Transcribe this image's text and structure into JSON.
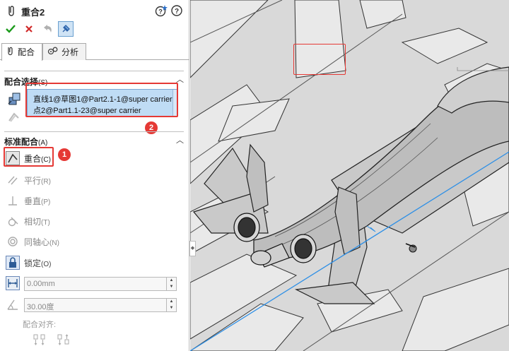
{
  "header": {
    "title": "重合2",
    "icon": "paperclip-icon",
    "help_icons": [
      "help-star-icon",
      "help-icon"
    ]
  },
  "actions": {
    "ok_icon": "checkmark-icon",
    "cancel_icon": "x-icon",
    "undo_icon": "undo-icon",
    "pin_icon": "pushpin-icon"
  },
  "tabs": [
    {
      "label": "配合",
      "icon": "paperclip-icon",
      "active": true
    },
    {
      "label": "分析",
      "icon": "gears-icon",
      "active": false
    }
  ],
  "mate_selection": {
    "title": "配合选择",
    "hotkey": "(S)",
    "items": [
      "直线1@草图1@Part2.1-1@super carrier",
      "点2@Part1.1-23@super carrier"
    ],
    "badge": "2"
  },
  "standard_mates": {
    "title": "标准配合",
    "hotkey": "(A)",
    "badge": "1",
    "items": [
      {
        "label": "重合",
        "hotkey": "(C)",
        "icon": "coincident-icon",
        "active": true
      },
      {
        "label": "平行",
        "hotkey": "(R)",
        "icon": "parallel-icon",
        "active": false
      },
      {
        "label": "垂直",
        "hotkey": "(P)",
        "icon": "perpendicular-icon",
        "active": false
      },
      {
        "label": "相切",
        "hotkey": "(T)",
        "icon": "tangent-icon",
        "active": false
      },
      {
        "label": "同轴心",
        "hotkey": "(N)",
        "icon": "concentric-icon",
        "active": false
      },
      {
        "label": "锁定",
        "hotkey": "(O)",
        "icon": "lock-icon",
        "active": false
      }
    ],
    "distance": "0.00mm",
    "angle": "30.00度",
    "alignment_label": "配合对齐:"
  },
  "colors": {
    "highlight": "#e53935",
    "selection_bg": "#bfdcf5",
    "axis_line": "#2d8fe6"
  }
}
